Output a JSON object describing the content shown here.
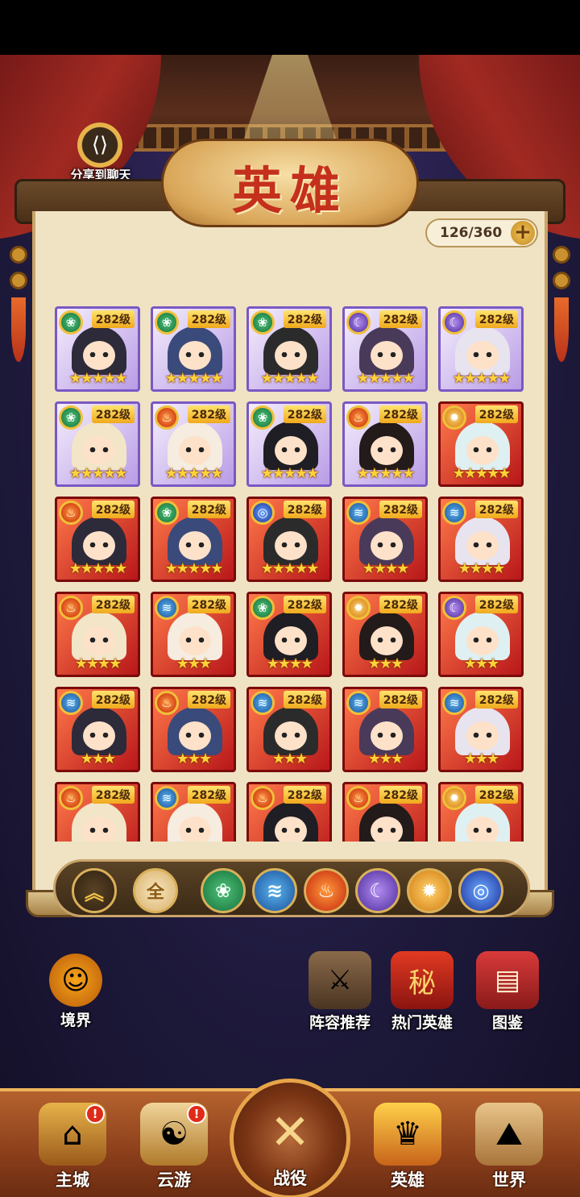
{
  "share": {
    "label": "分享到聊天",
    "icon": "share-icon"
  },
  "title": "英雄",
  "capacity": {
    "text": "126/360",
    "add_icon": "+"
  },
  "heroes": [
    {
      "level": "282级",
      "element": "wood",
      "stars": 5,
      "frame": "purple"
    },
    {
      "level": "282级",
      "element": "wood",
      "stars": 5,
      "frame": "purple"
    },
    {
      "level": "282级",
      "element": "wood",
      "stars": 5,
      "frame": "purple"
    },
    {
      "level": "282级",
      "element": "moon",
      "stars": 5,
      "frame": "purple"
    },
    {
      "level": "282级",
      "element": "moon",
      "stars": 5,
      "frame": "purple"
    },
    {
      "level": "282级",
      "element": "wood",
      "stars": 5,
      "frame": "purple"
    },
    {
      "level": "282级",
      "element": "fire",
      "stars": 5,
      "frame": "purple"
    },
    {
      "level": "282级",
      "element": "wood",
      "stars": 5,
      "frame": "purple"
    },
    {
      "level": "282级",
      "element": "fire",
      "stars": 5,
      "frame": "purple"
    },
    {
      "level": "282级",
      "element": "sun",
      "stars": 5,
      "frame": "red"
    },
    {
      "level": "282级",
      "element": "fire",
      "stars": 5,
      "frame": "red"
    },
    {
      "level": "282级",
      "element": "wood",
      "stars": 5,
      "frame": "red"
    },
    {
      "level": "282级",
      "element": "vortex",
      "stars": 5,
      "frame": "red"
    },
    {
      "level": "282级",
      "element": "water",
      "stars": 4,
      "frame": "red"
    },
    {
      "level": "282级",
      "element": "water",
      "stars": 4,
      "frame": "red"
    },
    {
      "level": "282级",
      "element": "fire",
      "stars": 4,
      "frame": "red"
    },
    {
      "level": "282级",
      "element": "water",
      "stars": 3,
      "frame": "red"
    },
    {
      "level": "282级",
      "element": "wood",
      "stars": 4,
      "frame": "red"
    },
    {
      "level": "282级",
      "element": "sun",
      "stars": 3,
      "frame": "red"
    },
    {
      "level": "282级",
      "element": "moon",
      "stars": 3,
      "frame": "red"
    },
    {
      "level": "282级",
      "element": "water",
      "stars": 3,
      "frame": "red"
    },
    {
      "level": "282级",
      "element": "fire",
      "stars": 3,
      "frame": "red"
    },
    {
      "level": "282级",
      "element": "water",
      "stars": 3,
      "frame": "red"
    },
    {
      "level": "282级",
      "element": "water",
      "stars": 3,
      "frame": "red"
    },
    {
      "level": "282级",
      "element": "water",
      "stars": 3,
      "frame": "red"
    },
    {
      "level": "282级",
      "element": "fire",
      "stars": 0,
      "frame": "red"
    },
    {
      "level": "282级",
      "element": "water",
      "stars": 0,
      "frame": "red"
    },
    {
      "level": "282级",
      "element": "fire",
      "stars": 0,
      "frame": "red"
    },
    {
      "level": "282级",
      "element": "fire",
      "stars": 0,
      "frame": "red"
    },
    {
      "level": "282级",
      "element": "sun",
      "stars": 0,
      "frame": "red"
    }
  ],
  "filters": {
    "collapse_icon": "︽",
    "all_label": "全",
    "elements": [
      {
        "name": "wood",
        "icon": "❀"
      },
      {
        "name": "water",
        "icon": "≋"
      },
      {
        "name": "fire",
        "icon": "♨"
      },
      {
        "name": "moon",
        "icon": "☾"
      },
      {
        "name": "sun",
        "icon": "✹"
      },
      {
        "name": "vortex",
        "icon": "◎"
      }
    ]
  },
  "side": {
    "realm": "境界",
    "lineup": "阵容推荐",
    "hot_heroes": "热门英雄",
    "codex": "图鉴"
  },
  "nav": [
    {
      "label": "主城",
      "icon": "city-icon",
      "badge": "!"
    },
    {
      "label": "云游",
      "icon": "travel-icon",
      "badge": "!"
    },
    {
      "label": "战役",
      "icon": "battle-icon",
      "badge": ""
    },
    {
      "label": "英雄",
      "icon": "hero-icon",
      "badge": ""
    },
    {
      "label": "世界",
      "icon": "world-icon",
      "badge": ""
    }
  ],
  "element_glyphs": {
    "wood": "❀",
    "water": "≋",
    "fire": "♨",
    "moon": "☾",
    "sun": "✹",
    "vortex": "◎"
  },
  "colors": {
    "accent": "#e9b84a",
    "panel": "#efe3c4",
    "title": "#c4301c"
  }
}
